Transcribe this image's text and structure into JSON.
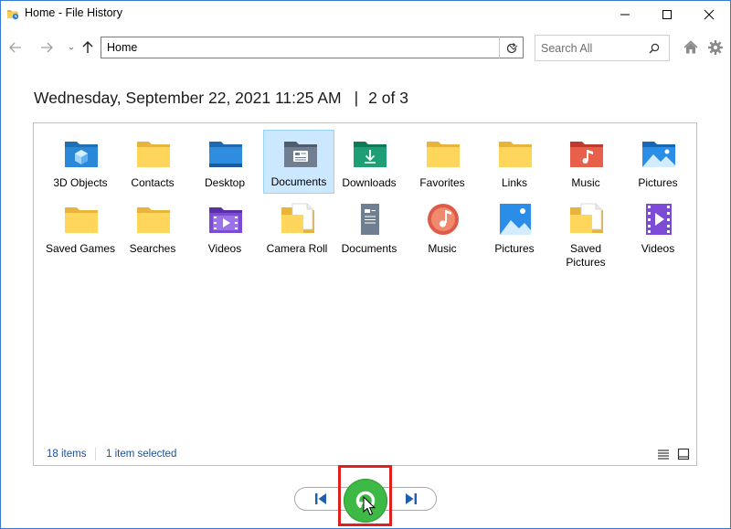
{
  "window": {
    "title": "Home - File History"
  },
  "address_bar": {
    "path": "Home"
  },
  "search": {
    "placeholder": "Search All"
  },
  "snapshot": {
    "date": "Wednesday, September 22, 2021 11:25 AM",
    "separator": "|",
    "position": "2 of 3"
  },
  "items": [
    {
      "label": "3D Objects",
      "icon": "3d-objects-folder-icon"
    },
    {
      "label": "Contacts",
      "icon": "folder-icon"
    },
    {
      "label": "Desktop",
      "icon": "desktop-folder-icon"
    },
    {
      "label": "Documents",
      "icon": "documents-folder-icon",
      "selected": true
    },
    {
      "label": "Downloads",
      "icon": "downloads-folder-icon"
    },
    {
      "label": "Favorites",
      "icon": "folder-icon"
    },
    {
      "label": "Links",
      "icon": "folder-icon"
    },
    {
      "label": "Music",
      "icon": "music-folder-icon"
    },
    {
      "label": "Pictures",
      "icon": "pictures-folder-icon"
    },
    {
      "label": "Saved Games",
      "icon": "folder-icon"
    },
    {
      "label": "Searches",
      "icon": "folder-icon"
    },
    {
      "label": "Videos",
      "icon": "videos-folder-icon"
    },
    {
      "label": "Camera Roll",
      "icon": "folder-with-file-icon"
    },
    {
      "label": "Documents",
      "icon": "documents-library-icon"
    },
    {
      "label": "Music",
      "icon": "music-library-icon"
    },
    {
      "label": "Pictures",
      "icon": "pictures-library-icon"
    },
    {
      "label": "Saved Pictures",
      "icon": "folder-with-file-icon"
    },
    {
      "label": "Videos",
      "icon": "videos-library-icon"
    }
  ],
  "status": {
    "count": "18 items",
    "selection": "1 item selected"
  },
  "colors": {
    "accent": "#0078d7",
    "selection_bg": "#cce8ff",
    "restore_green": "#3fb945",
    "highlight_red": "#e01f1f",
    "folder_yellow": "#ffd65c"
  }
}
